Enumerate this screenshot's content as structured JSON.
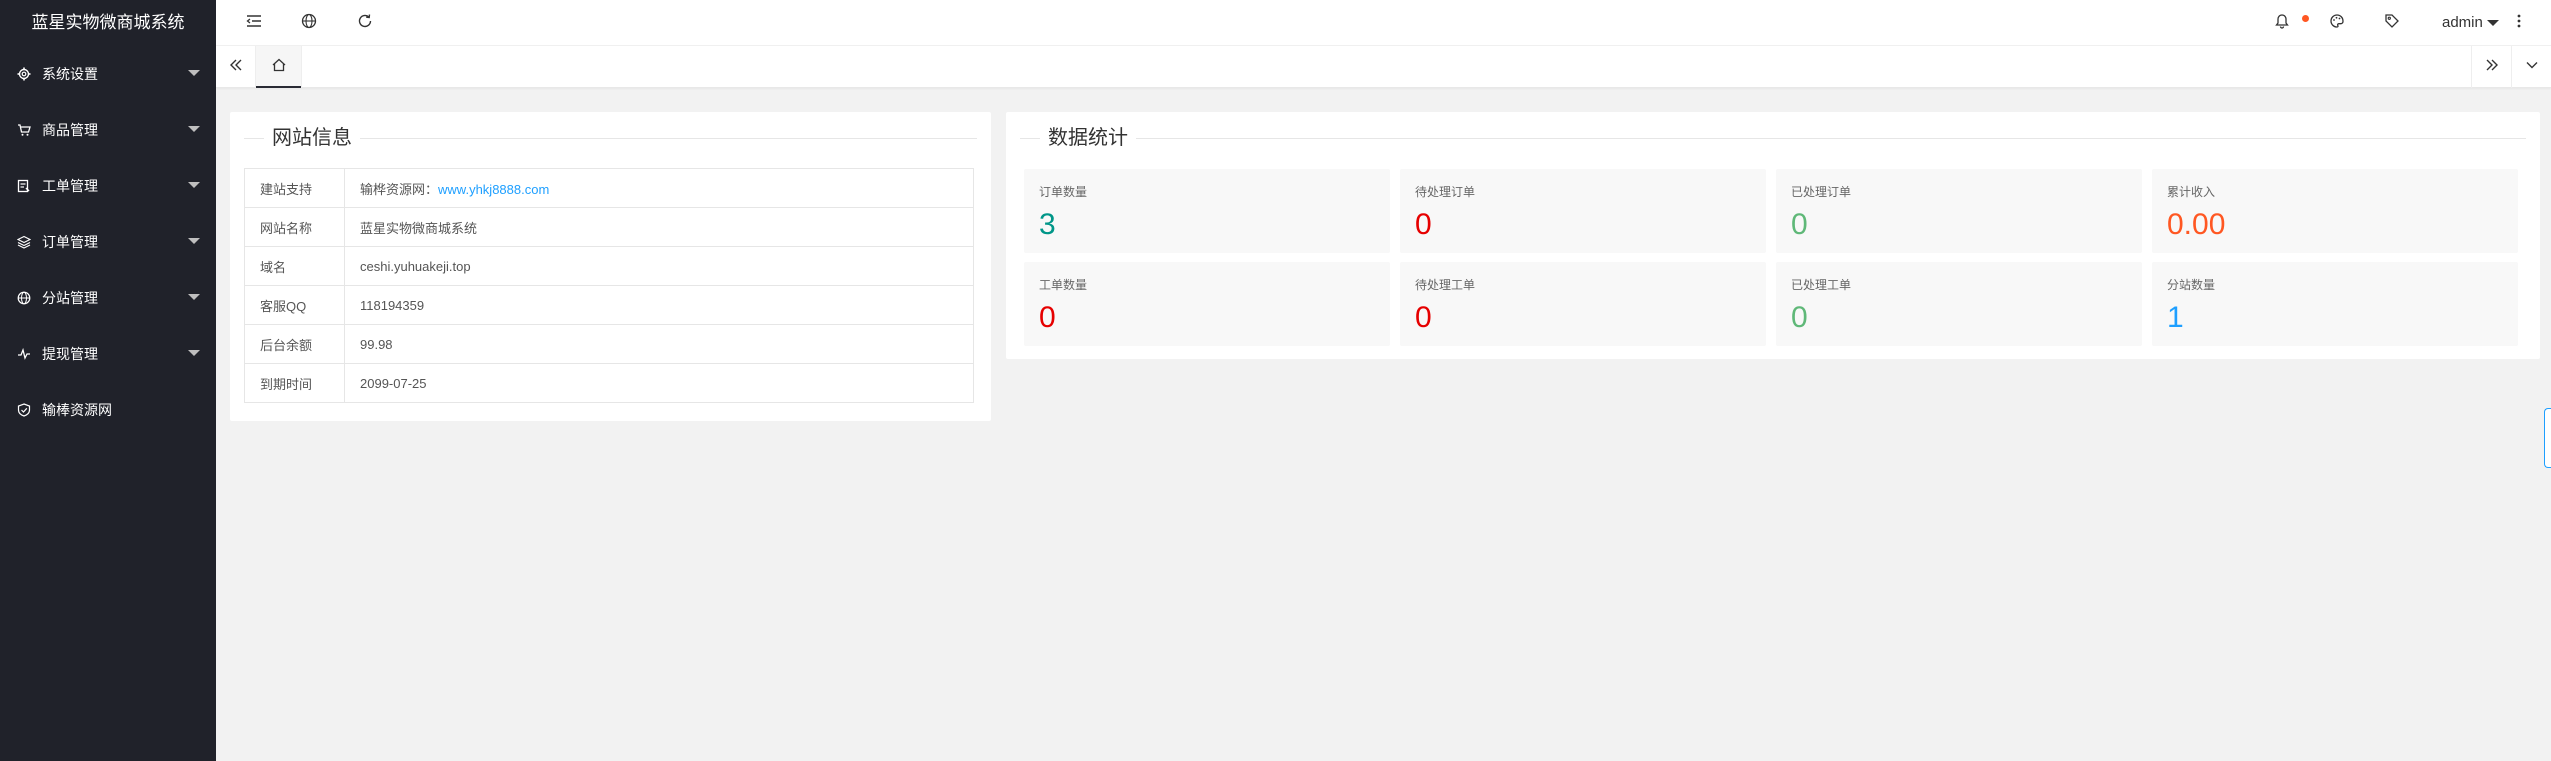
{
  "app": {
    "title": "蓝星实物微商城系统"
  },
  "sidebar": {
    "items": [
      {
        "label": "系统设置",
        "icon": "gear-icon",
        "has_submenu": true
      },
      {
        "label": "商品管理",
        "icon": "cart-icon",
        "has_submenu": true
      },
      {
        "label": "工单管理",
        "icon": "ticket-icon",
        "has_submenu": true
      },
      {
        "label": "订单管理",
        "icon": "layers-icon",
        "has_submenu": true
      },
      {
        "label": "分站管理",
        "icon": "globe-icon",
        "has_submenu": true
      },
      {
        "label": "提现管理",
        "icon": "pulse-icon",
        "has_submenu": true
      },
      {
        "label": "输棒资源网",
        "icon": "shield-icon",
        "has_submenu": false
      }
    ]
  },
  "header": {
    "user": "admin",
    "notification_dot_color": "#ff5722"
  },
  "site_info": {
    "title": "网站信息",
    "rows": [
      {
        "key": "建站支持",
        "prefix": "输桦资源网：",
        "link": "www.yhkj8888.com"
      },
      {
        "key": "网站名称",
        "value": "蓝星实物微商城系统"
      },
      {
        "key": "域名",
        "value": "ceshi.yuhuakeji.top"
      },
      {
        "key": "客服QQ",
        "value": "118194359"
      },
      {
        "key": "后台余额",
        "value": "99.98"
      },
      {
        "key": "到期时间",
        "value": "2099-07-25"
      }
    ]
  },
  "stats": {
    "title": "数据统计",
    "items": [
      {
        "label": "订单数量",
        "value": "3",
        "color": "#009688"
      },
      {
        "label": "待处理订单",
        "value": "0",
        "color": "#e60000"
      },
      {
        "label": "已处理订单",
        "value": "0",
        "color": "#5fb878"
      },
      {
        "label": "累计收入",
        "value": "0.00",
        "color": "#ff5722"
      },
      {
        "label": "工单数量",
        "value": "0",
        "color": "#e60000"
      },
      {
        "label": "待处理工单",
        "value": "0",
        "color": "#e60000"
      },
      {
        "label": "已处理工单",
        "value": "0",
        "color": "#5fb878"
      },
      {
        "label": "分站数量",
        "value": "1",
        "color": "#1e9fff"
      }
    ]
  }
}
